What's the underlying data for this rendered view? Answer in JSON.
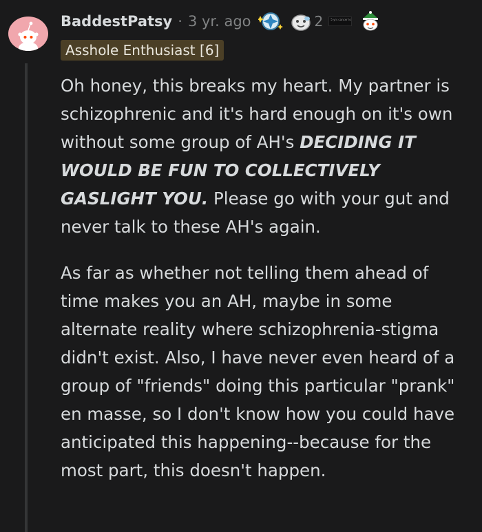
{
  "comment": {
    "username": "BaddestPatsy",
    "separator": "·",
    "age": "3 yr. ago",
    "award_count": "2",
    "small_award_text": "5 yrs cancer loving life not single, 3 kids, untreated, depressed",
    "flair": "Asshole Enthusiast [6]",
    "paragraph1": {
      "part1": "Oh honey, this breaks my heart. My partner is schizophrenic and it's hard enough on it's own without some group of AH's ",
      "emphasis": "DECIDING IT WOULD BE FUN TO COLLECTIVELY GASLIGHT YOU.",
      "part2": " Please go with your gut and never talk to these AH's again."
    },
    "paragraph2": "As far as whether not telling them ahead of time makes you an AH, maybe in some alternate reality where schizophrenia-stigma didn't exist. Also, I have never even heard of a group of \"friends\" doing this particular \"prank\" en masse, so I don't know how you could have anticipated this happening--because for the most part, this doesn't happen."
  },
  "icons": {
    "avatar": "snoo-avatar",
    "award_1": "blue-sparkle-award-icon",
    "award_2": "wholesome-award-icon",
    "award_3": "snoo-elf-award-icon"
  },
  "colors": {
    "background": "#1a1a1b",
    "text": "#d7dadc",
    "meta": "#818384",
    "flair_bg": "#4b3f26",
    "avatar_bg": "#f1a7ad"
  }
}
